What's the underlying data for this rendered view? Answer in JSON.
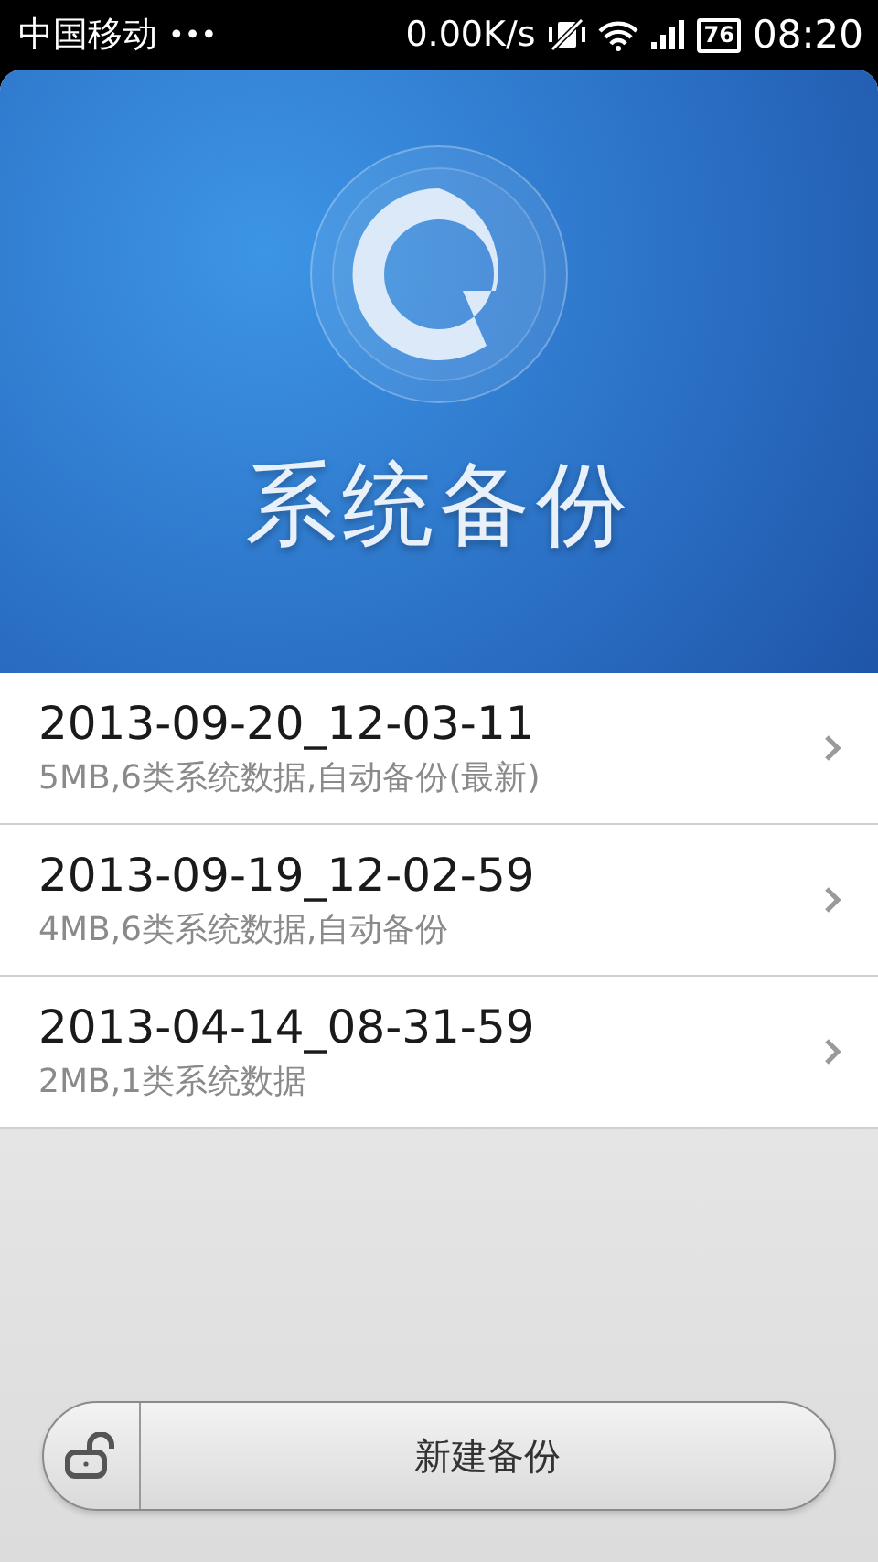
{
  "status_bar": {
    "carrier": "中国移动",
    "dots": "•••",
    "speed": "0.00K/s",
    "battery": "76",
    "time": "08:20"
  },
  "header": {
    "title": "系统备份"
  },
  "backups": [
    {
      "name": "2013-09-20_12-03-11",
      "details": "5MB,6类系统数据,自动备份(最新)"
    },
    {
      "name": "2013-09-19_12-02-59",
      "details": "4MB,6类系统数据,自动备份"
    },
    {
      "name": "2013-04-14_08-31-59",
      "details": "2MB,1类系统数据"
    }
  ],
  "new_backup_button": {
    "label": "新建备份"
  }
}
